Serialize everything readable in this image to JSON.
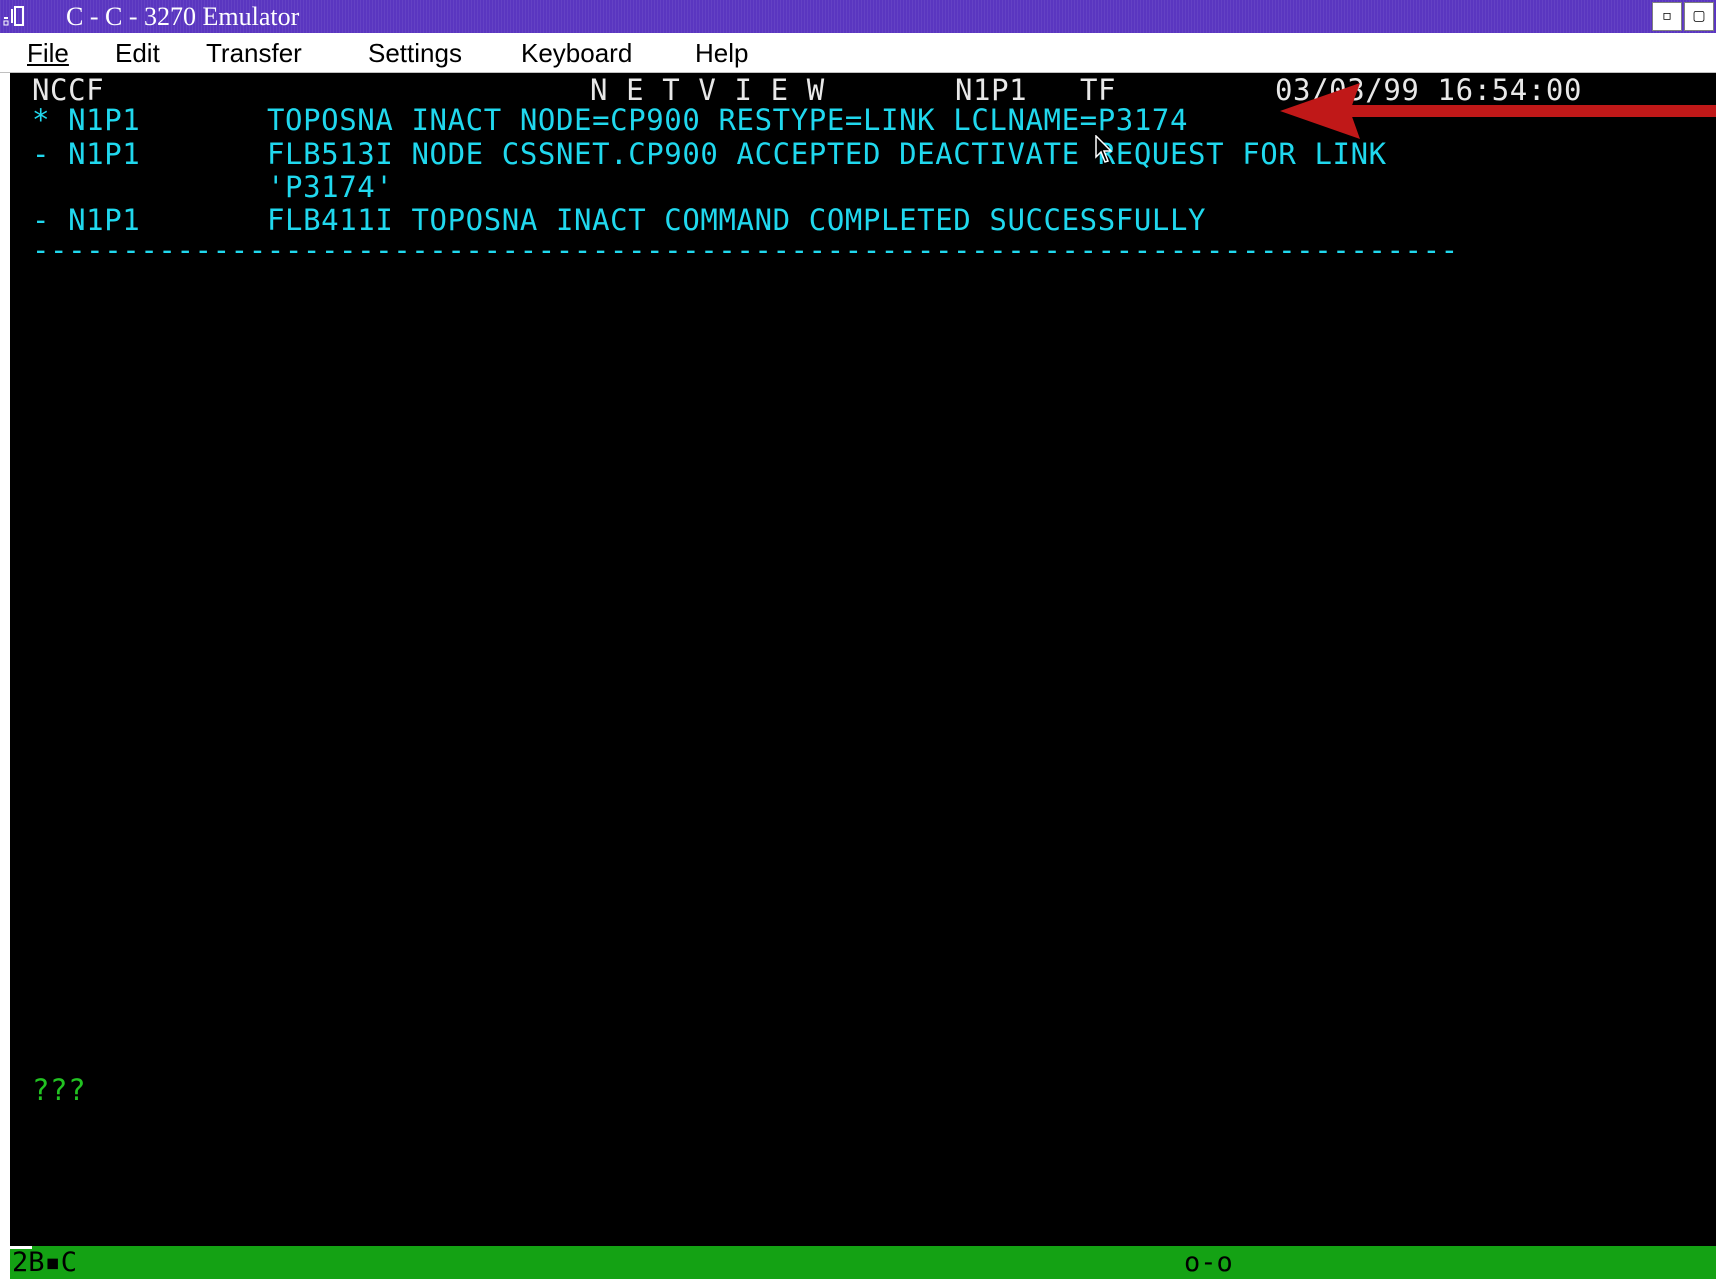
{
  "window": {
    "title": "C - C - 3270 Emulator",
    "sysmenu_icon": "3270-terminal-icon",
    "buttons": {
      "minimize_icon": "minimize-icon",
      "maximize_icon": "maximize-icon"
    }
  },
  "menubar": {
    "items": [
      {
        "label": "File"
      },
      {
        "label": "Edit"
      },
      {
        "label": "Transfer"
      },
      {
        "label": "Settings"
      },
      {
        "label": "Keyboard"
      },
      {
        "label": "Help"
      }
    ]
  },
  "terminal": {
    "header": {
      "app": "NCCF",
      "product": "N E T V I E W",
      "domain": "N1P1",
      "mode": "TF",
      "timestamp": "03/03/99 16:54:00"
    },
    "messages": [
      {
        "prefix": "* N1P1",
        "text": "TOPOSNA INACT NODE=CP900 RESTYPE=LINK LCLNAME=P3174"
      },
      {
        "prefix": "- N1P1",
        "text": "FLB513I NODE CSSNET.CP900 ACCEPTED DEACTIVATE REQUEST FOR LINK"
      },
      {
        "prefix": "",
        "text": "'P3174'"
      },
      {
        "prefix": "- N1P1",
        "text": "FLB411I TOPOSNA INACT COMMAND COMPLETED SUCCESSFULLY"
      }
    ],
    "separator": "-------------------------------------------------------------------------------",
    "prompt": "???"
  },
  "statusbar": {
    "session": "2B▪C",
    "indicator": "o-o"
  },
  "colors": {
    "terminal_bg": "#000000",
    "text_cyan": "#20d8ee",
    "prompt_green": "#22c322",
    "statusbar_green": "#14a214",
    "titlebar": "#5a36c0",
    "annotation_arrow": "#c01818"
  }
}
